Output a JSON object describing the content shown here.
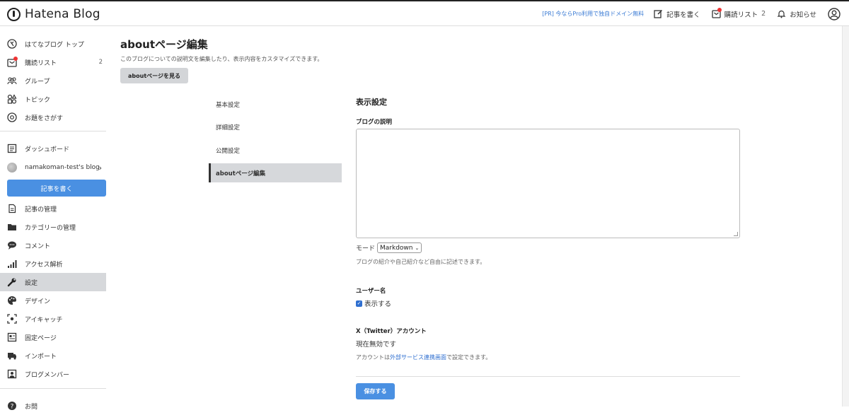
{
  "header": {
    "logo_text": "Hatena Blog",
    "pr_link": "[PR] 今ならPro利用で独自ドメイン無料",
    "write_label": "記事を書く",
    "subscriptions_label": "購読リスト",
    "subscriptions_count": "2",
    "notifications_label": "お知らせ",
    "notification_dot_color": "#e33333"
  },
  "sidebar": {
    "items": [
      {
        "label": "はてなブログ トップ",
        "icon": "hatena-icon"
      },
      {
        "label": "購読リスト",
        "icon": "subscription-icon",
        "count": "2"
      },
      {
        "label": "グループ",
        "icon": "group-icon"
      },
      {
        "label": "トピック",
        "icon": "topic-icon"
      },
      {
        "label": "お題をさがす",
        "icon": "theme-icon"
      },
      {
        "label": "ダッシュボード",
        "icon": "dashboard-icon"
      },
      {
        "label": "namakoman-test's blog",
        "icon": "blog-avatar"
      },
      {
        "label": "記事の管理",
        "icon": "document-icon"
      },
      {
        "label": "カテゴリーの管理",
        "icon": "folder-icon"
      },
      {
        "label": "コメント",
        "icon": "comment-icon"
      },
      {
        "label": "アクセス解析",
        "icon": "chart-icon"
      },
      {
        "label": "設定",
        "icon": "wrench-icon"
      },
      {
        "label": "デザイン",
        "icon": "palette-icon"
      },
      {
        "label": "アイキャッチ",
        "icon": "image-icon"
      },
      {
        "label": "固定ページ",
        "icon": "page-icon"
      },
      {
        "label": "インポート",
        "icon": "truck-icon"
      },
      {
        "label": "ブログメンバー",
        "icon": "members-icon"
      },
      {
        "label": "お問",
        "icon": "help-icon"
      }
    ],
    "write_button": "記事を書く",
    "accent_color": "#4a90e2"
  },
  "main": {
    "title": "aboutページ編集",
    "description": "このブログについての説明文を編集したり、表示内容をカスタマイズできます。",
    "view_button": "aboutページを見る",
    "tabs": [
      {
        "label": "基本設定"
      },
      {
        "label": "詳細設定"
      },
      {
        "label": "公開設定"
      },
      {
        "label": "aboutページ編集"
      }
    ],
    "form": {
      "section_title": "表示設定",
      "blog_description_label": "ブログの説明",
      "blog_description_value": "",
      "mode_label": "モード",
      "mode_value": "Markdown",
      "description_hint": "ブログの紹介や自己紹介など自由に記述できます。",
      "username_label": "ユーザー名",
      "username_checkbox_label": "表示する",
      "twitter_label": "X（Twitter）アカウント",
      "twitter_status": "現在無効です",
      "twitter_note_prefix": "アカウントは",
      "twitter_note_link": "外部サービス連携画面",
      "twitter_note_suffix": "で設定できます。",
      "save_button": "保存する"
    }
  }
}
